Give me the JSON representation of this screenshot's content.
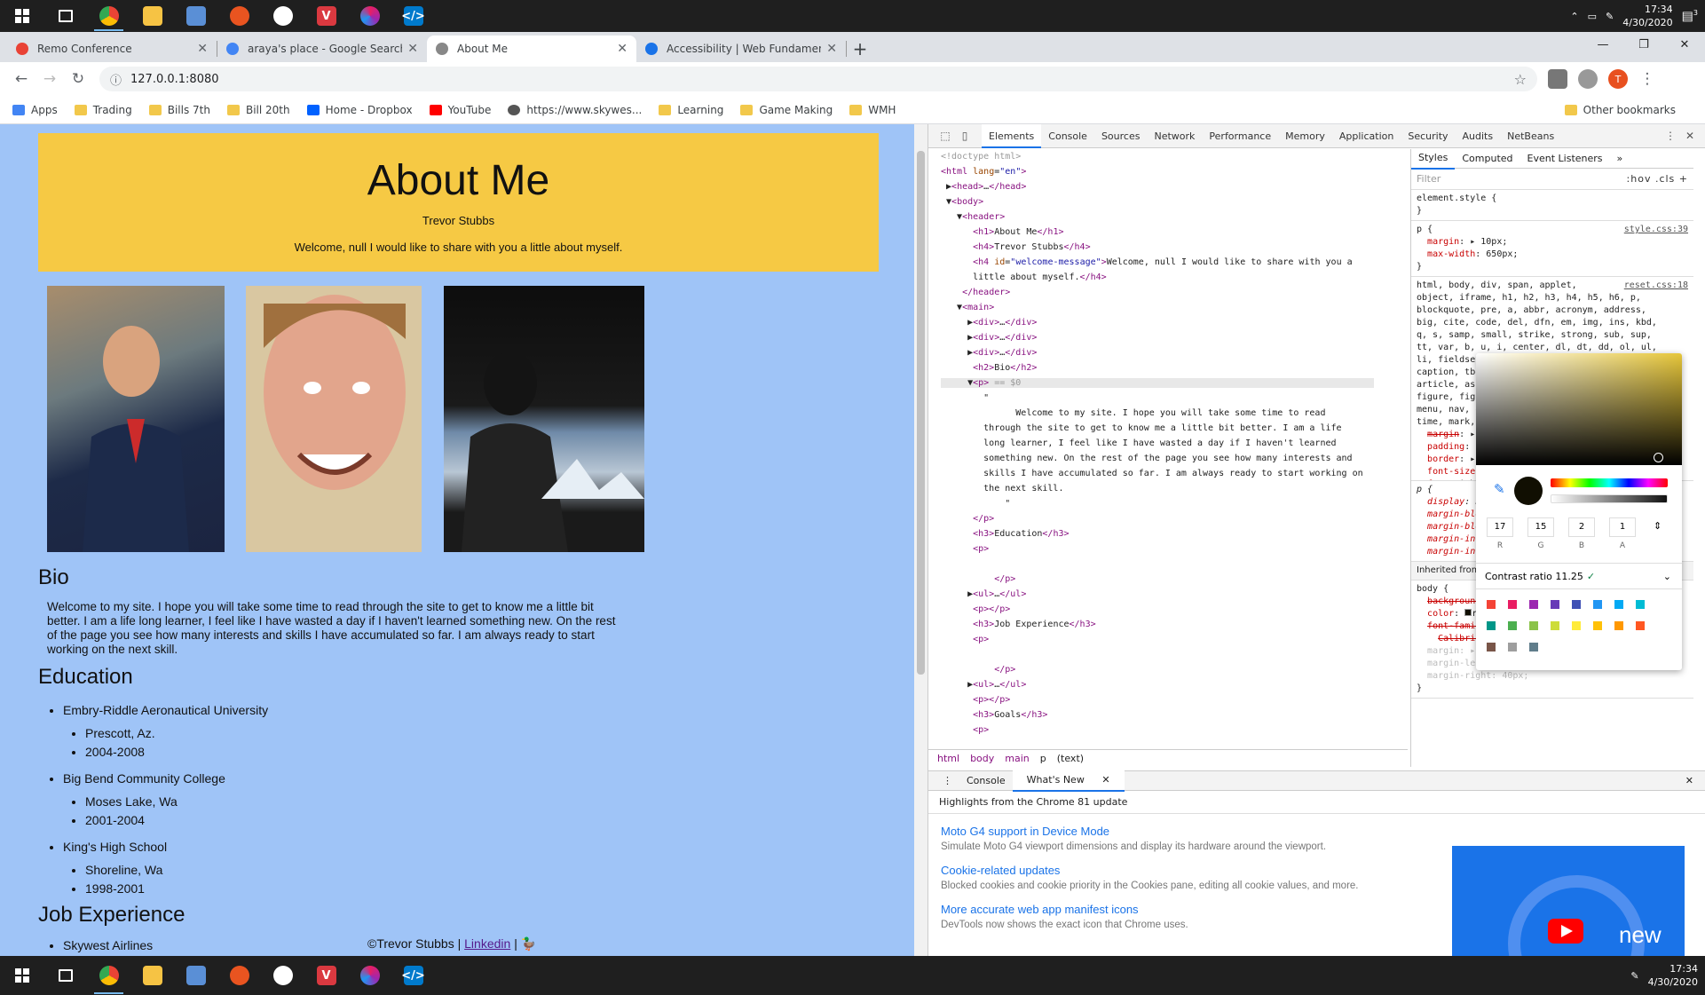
{
  "taskbar": {
    "time": "17:34",
    "date": "4/30/2020",
    "notif_count": "3"
  },
  "tabs": [
    {
      "title": "Remo Conference",
      "fav": "#e94235"
    },
    {
      "title": "araya's place - Google Search",
      "fav": "#4285f4"
    },
    {
      "title": "About Me",
      "fav": "#888888"
    },
    {
      "title": "Accessibility  |  Web Fundamenta",
      "fav": "#1a73e8"
    }
  ],
  "url": "127.0.0.1:8080",
  "avatar": "T",
  "bookmarks": [
    {
      "label": "Apps",
      "icon": "apps-grid-icon",
      "color": "#4285f4"
    },
    {
      "label": "Trading",
      "icon": "folder-icon",
      "color": "#f2c84b"
    },
    {
      "label": "Bills 7th",
      "icon": "folder-icon",
      "color": "#f2c84b"
    },
    {
      "label": "Bill 20th",
      "icon": "folder-icon",
      "color": "#f2c84b"
    },
    {
      "label": "Home - Dropbox",
      "icon": "dropbox-icon",
      "color": "#0061ff"
    },
    {
      "label": "YouTube",
      "icon": "youtube-icon",
      "color": "#ff0000"
    },
    {
      "label": "https://www.skywes...",
      "icon": "globe-icon",
      "color": "#555555"
    },
    {
      "label": "Learning",
      "icon": "folder-icon",
      "color": "#f2c84b"
    },
    {
      "label": "Game Making",
      "icon": "folder-icon",
      "color": "#f2c84b"
    },
    {
      "label": "WMH",
      "icon": "folder-icon",
      "color": "#f2c84b"
    }
  ],
  "other_bookmarks": "Other bookmarks",
  "page": {
    "title": "About Me",
    "name": "Trevor Stubbs",
    "welcome": "Welcome, null I would like to share with you a little about myself.",
    "bio_heading": "Bio",
    "bio": "Welcome to my site. I hope you will take some time to read through the site to get to know me a little bit better. I am a life long learner, I feel like I have wasted a day if I haven't learned something new. On the rest of the page you see how many interests and skills I have accumulated so far. I am always ready to start working on the next skill.",
    "education_heading": "Education",
    "education": [
      {
        "school": "Embry-Riddle Aeronautical University",
        "place": "Prescott, Az.",
        "years": "2004-2008"
      },
      {
        "school": "Big Bend Community College",
        "place": "Moses Lake, Wa",
        "years": "2001-2004"
      },
      {
        "school": "King's High School",
        "place": "Shoreline, Wa",
        "years": "1998-2001"
      }
    ],
    "job_heading": "Job Experience",
    "jobs": [
      "Skywest Airlines"
    ],
    "footer_text": "©Trevor Stubbs |",
    "footer_link": "Linkedin",
    "footer_sep": "|"
  },
  "devtools": {
    "tabs": [
      "Elements",
      "Console",
      "Sources",
      "Network",
      "Performance",
      "Memory",
      "Application",
      "Security",
      "Audits",
      "NetBeans"
    ],
    "more": "»",
    "styles_tabs": [
      "Styles",
      "Computed",
      "Event Listeners"
    ],
    "filter_placeholder": "Filter",
    "filter_tools": ":hov  .cls  +",
    "crumbs": [
      "html",
      "body",
      "main",
      "p",
      "(text)"
    ],
    "contrast_label": "Contrast ratio  11.25",
    "rgba": {
      "r": "17",
      "g": "15",
      "b": "2",
      "a": "1"
    },
    "rgba_labels": [
      "R",
      "G",
      "B",
      "A"
    ],
    "drawer_tabs": [
      "Console",
      "What's New"
    ],
    "whats_new_header": "Highlights from the Chrome 81 update",
    "whats_new": [
      {
        "title": "Moto G4 support in Device Mode",
        "desc": "Simulate Moto G4 viewport dimensions and display its hardware around the viewport."
      },
      {
        "title": "Cookie-related updates",
        "desc": "Blocked cookies and cookie priority in the Cookies pane, editing all cookie values, and more."
      },
      {
        "title": "More accurate web app manifest icons",
        "desc": "DevTools now shows the exact icon that Chrome uses."
      }
    ],
    "banner_text": "new"
  }
}
